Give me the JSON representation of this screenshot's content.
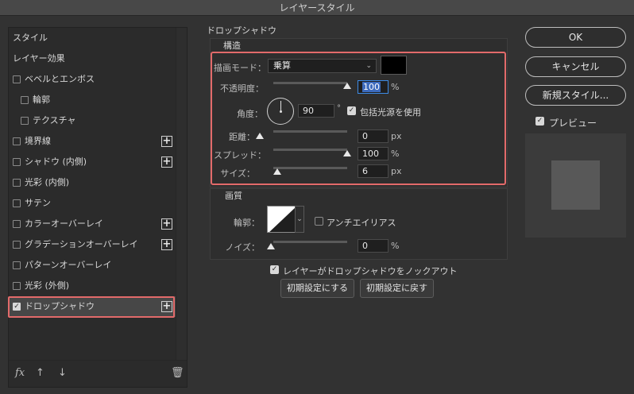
{
  "window": {
    "title": "レイヤースタイル"
  },
  "styles_list": {
    "items": [
      {
        "label": "スタイル",
        "type": "header"
      },
      {
        "label": "レイヤー効果",
        "type": "header"
      },
      {
        "label": "ベベルとエンボス",
        "checked": false,
        "plus": false
      },
      {
        "label": "輪郭",
        "checked": false,
        "plus": false,
        "indent": true
      },
      {
        "label": "テクスチャ",
        "checked": false,
        "plus": false,
        "indent": true
      },
      {
        "label": "境界線",
        "checked": false,
        "plus": true
      },
      {
        "label": "シャドウ (内側)",
        "checked": false,
        "plus": true
      },
      {
        "label": "光彩 (内側)",
        "checked": false,
        "plus": false
      },
      {
        "label": "サテン",
        "checked": false,
        "plus": false
      },
      {
        "label": "カラーオーバーレイ",
        "checked": false,
        "plus": true
      },
      {
        "label": "グラデーションオーバーレイ",
        "checked": false,
        "plus": true
      },
      {
        "label": "パターンオーバーレイ",
        "checked": false,
        "plus": false
      },
      {
        "label": "光彩 (外側)",
        "checked": false,
        "plus": false
      },
      {
        "label": "ドロップシャドウ",
        "checked": true,
        "plus": true,
        "selected": true
      }
    ],
    "footer": {
      "fx_label": "fx"
    }
  },
  "drop_shadow": {
    "title": "ドロップシャドウ",
    "structure": {
      "title": "構造",
      "blend_mode_label": "描画モード：",
      "blend_mode_value": "乗算",
      "shadow_color": "#000000",
      "opacity_label": "不透明度：",
      "opacity_value": "100",
      "opacity_unit": "%",
      "opacity_level": 1.0,
      "angle_label": "角度：",
      "angle_value": "90",
      "angle_unit": "°",
      "global_light_label": "包括光源を使用",
      "global_light_checked": true,
      "distance_label": "距離：",
      "distance_value": "0",
      "distance_unit": "px",
      "distance_level": 0.0,
      "spread_label": "スプレッド：",
      "spread_value": "100",
      "spread_unit": "%",
      "spread_level": 1.0,
      "size_label": "サイズ：",
      "size_value": "6",
      "size_unit": "px",
      "size_level": 0.05
    },
    "quality": {
      "title": "画質",
      "contour_label": "輪郭：",
      "anti_alias_label": "アンチエイリアス",
      "anti_alias_checked": false,
      "noise_label": "ノイズ：",
      "noise_value": "0",
      "noise_unit": "%",
      "noise_level": 0.0
    },
    "knockout_label": "レイヤーがドロップシャドウをノックアウト",
    "knockout_checked": true,
    "make_default_label": "初期設定にする",
    "reset_default_label": "初期設定に戻す"
  },
  "buttons": {
    "ok": "OK",
    "cancel": "キャンセル",
    "new_style": "新規スタイル..."
  },
  "preview": {
    "label": "プレビュー",
    "checked": true
  },
  "colors": {
    "highlight": "#e26a6a",
    "accent": "#3d8be6"
  }
}
